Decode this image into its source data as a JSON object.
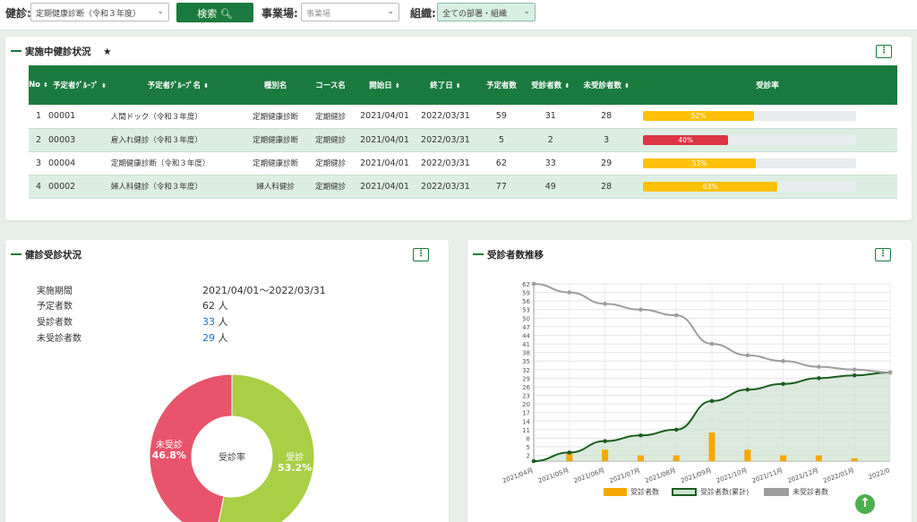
{
  "filters": {
    "kenshin_label": "健診:",
    "kenshin_value": "定期健康診断（令和３年度）",
    "search_label": "検索",
    "jigyosho_label": "事業場:",
    "jigyosho_placeholder": "事業場",
    "soshiki_label": "組織:",
    "soshiki_value": "全ての部署・組織"
  },
  "active": {
    "title": "実施中健診状況",
    "star": "★",
    "headers": [
      "No",
      "予定者ｸﾞﾙｰﾌﾟ",
      "予定者ｸﾞﾙｰﾌﾟ名",
      "種別名",
      "コース名",
      "開始日",
      "終了日",
      "予定者数",
      "受診者数",
      "未受診者数",
      "受診率"
    ],
    "rows": [
      {
        "no": "1",
        "group": "00001",
        "name": "人間ドック（令和３年度）",
        "type": "定期健康診断",
        "course": "定期健診",
        "start": "2021/04/01",
        "end": "2022/03/31",
        "planned": "59",
        "done": "31",
        "notdone": "28",
        "rate": 52,
        "rate_label": "52%",
        "color": "#ffc107"
      },
      {
        "no": "2",
        "group": "00003",
        "name": "雇入れ健診（令和３年度）",
        "type": "定期健康診断",
        "course": "定期健診",
        "start": "2021/04/01",
        "end": "2022/03/31",
        "planned": "5",
        "done": "2",
        "notdone": "3",
        "rate": 40,
        "rate_label": "40%",
        "color": "#dc3545"
      },
      {
        "no": "3",
        "group": "00004",
        "name": "定期健康診断（令和３年度）",
        "type": "定期健康診断",
        "course": "定期健診",
        "start": "2021/04/01",
        "end": "2022/03/31",
        "planned": "62",
        "done": "33",
        "notdone": "29",
        "rate": 53,
        "rate_label": "53%",
        "color": "#ffc107"
      },
      {
        "no": "4",
        "group": "00002",
        "name": "婦人科健診（令和３年度）",
        "type": "婦人科健診",
        "course": "定期健診",
        "start": "2021/04/01",
        "end": "2022/03/31",
        "planned": "77",
        "done": "49",
        "notdone": "28",
        "rate": 63,
        "rate_label": "63%",
        "color": "#ffc107"
      }
    ]
  },
  "status": {
    "title": "健診受診状況",
    "period_label": "実施期間",
    "period_value": "2021/04/01～2022/03/31",
    "planned_label": "予定者数",
    "planned_value": "62",
    "done_label": "受診者数",
    "done_value": "33",
    "notdone_label": "未受診者数",
    "notdone_value": "29",
    "unit": "人"
  },
  "trend": {
    "title": "受診者数推移"
  },
  "colors": {
    "accent": "#1b7a3d",
    "done": "#a8cf45",
    "notdone": "#e8546b",
    "bar": "#f5a800",
    "gray": "#9e9e9e"
  },
  "chart_data": [
    {
      "type": "pie",
      "title": "",
      "center_label": "受診率",
      "slices": [
        {
          "label": "受診",
          "value": 53.2,
          "label_value": "53.2%",
          "color": "#a8cf45"
        },
        {
          "label": "未受診",
          "value": 46.8,
          "label_value": "46.8%",
          "color": "#e8546b"
        }
      ]
    },
    {
      "type": "line",
      "title": "",
      "x": [
        "2021/04月",
        "2021/05月",
        "2021/06月",
        "2021/07月",
        "2021/08月",
        "2021/09月",
        "2021/10月",
        "2021/11月",
        "2021/12月",
        "2022/01月",
        "2022/0"
      ],
      "yticks": [
        2,
        5,
        8,
        11,
        14,
        17,
        20,
        23,
        26,
        29,
        32,
        35,
        38,
        41,
        44,
        47,
        50,
        53,
        56,
        59,
        62
      ],
      "ylim": [
        0,
        62
      ],
      "grid": true,
      "legend": "bottom",
      "series": [
        {
          "name": "受診者数",
          "kind": "bar",
          "color": "#f5a800",
          "values": [
            0,
            3,
            4,
            2,
            2,
            10,
            4,
            2,
            2,
            1,
            0
          ]
        },
        {
          "name": "受診者数(累計)",
          "kind": "area",
          "color": "#1b5e20",
          "values": [
            0,
            3,
            7,
            9,
            11,
            21,
            25,
            27,
            29,
            30,
            31
          ]
        },
        {
          "name": "未受診者数",
          "kind": "line",
          "color": "#9e9e9e",
          "values": [
            62,
            59,
            55,
            53,
            51,
            41,
            37,
            35,
            33,
            32,
            31
          ]
        }
      ]
    }
  ]
}
